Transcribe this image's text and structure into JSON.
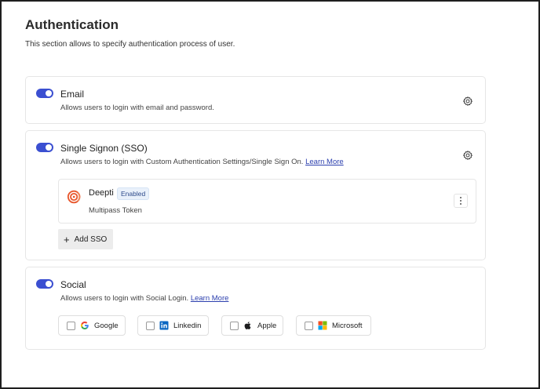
{
  "header": {
    "title": "Authentication",
    "subtitle": "This section allows to specify authentication process of user."
  },
  "email": {
    "title": "Email",
    "description": "Allows users to login with email and password.",
    "enabled": true
  },
  "sso": {
    "title": "Single Signon (SSO)",
    "description": "Allows users to login with Custom Authentication Settings/Single Sign On.",
    "learn_more": "Learn More",
    "enabled": true,
    "provider": {
      "name": "Deepti",
      "badge": "Enabled",
      "type": "Multipass Token"
    },
    "add_label": "Add SSO"
  },
  "social": {
    "title": "Social",
    "description": "Allows users to login with Social Login.",
    "learn_more": "Learn More",
    "enabled": true,
    "options": [
      {
        "label": "Google",
        "icon": "google-icon",
        "checked": false
      },
      {
        "label": "Linkedin",
        "icon": "linkedin-icon",
        "checked": false
      },
      {
        "label": "Apple",
        "icon": "apple-icon",
        "checked": false
      },
      {
        "label": "Microsoft",
        "icon": "microsoft-icon",
        "checked": false
      }
    ]
  },
  "colors": {
    "toggle_on": "#3b4fd1",
    "link": "#2b3fae",
    "badge_bg": "#e9f1fb"
  }
}
